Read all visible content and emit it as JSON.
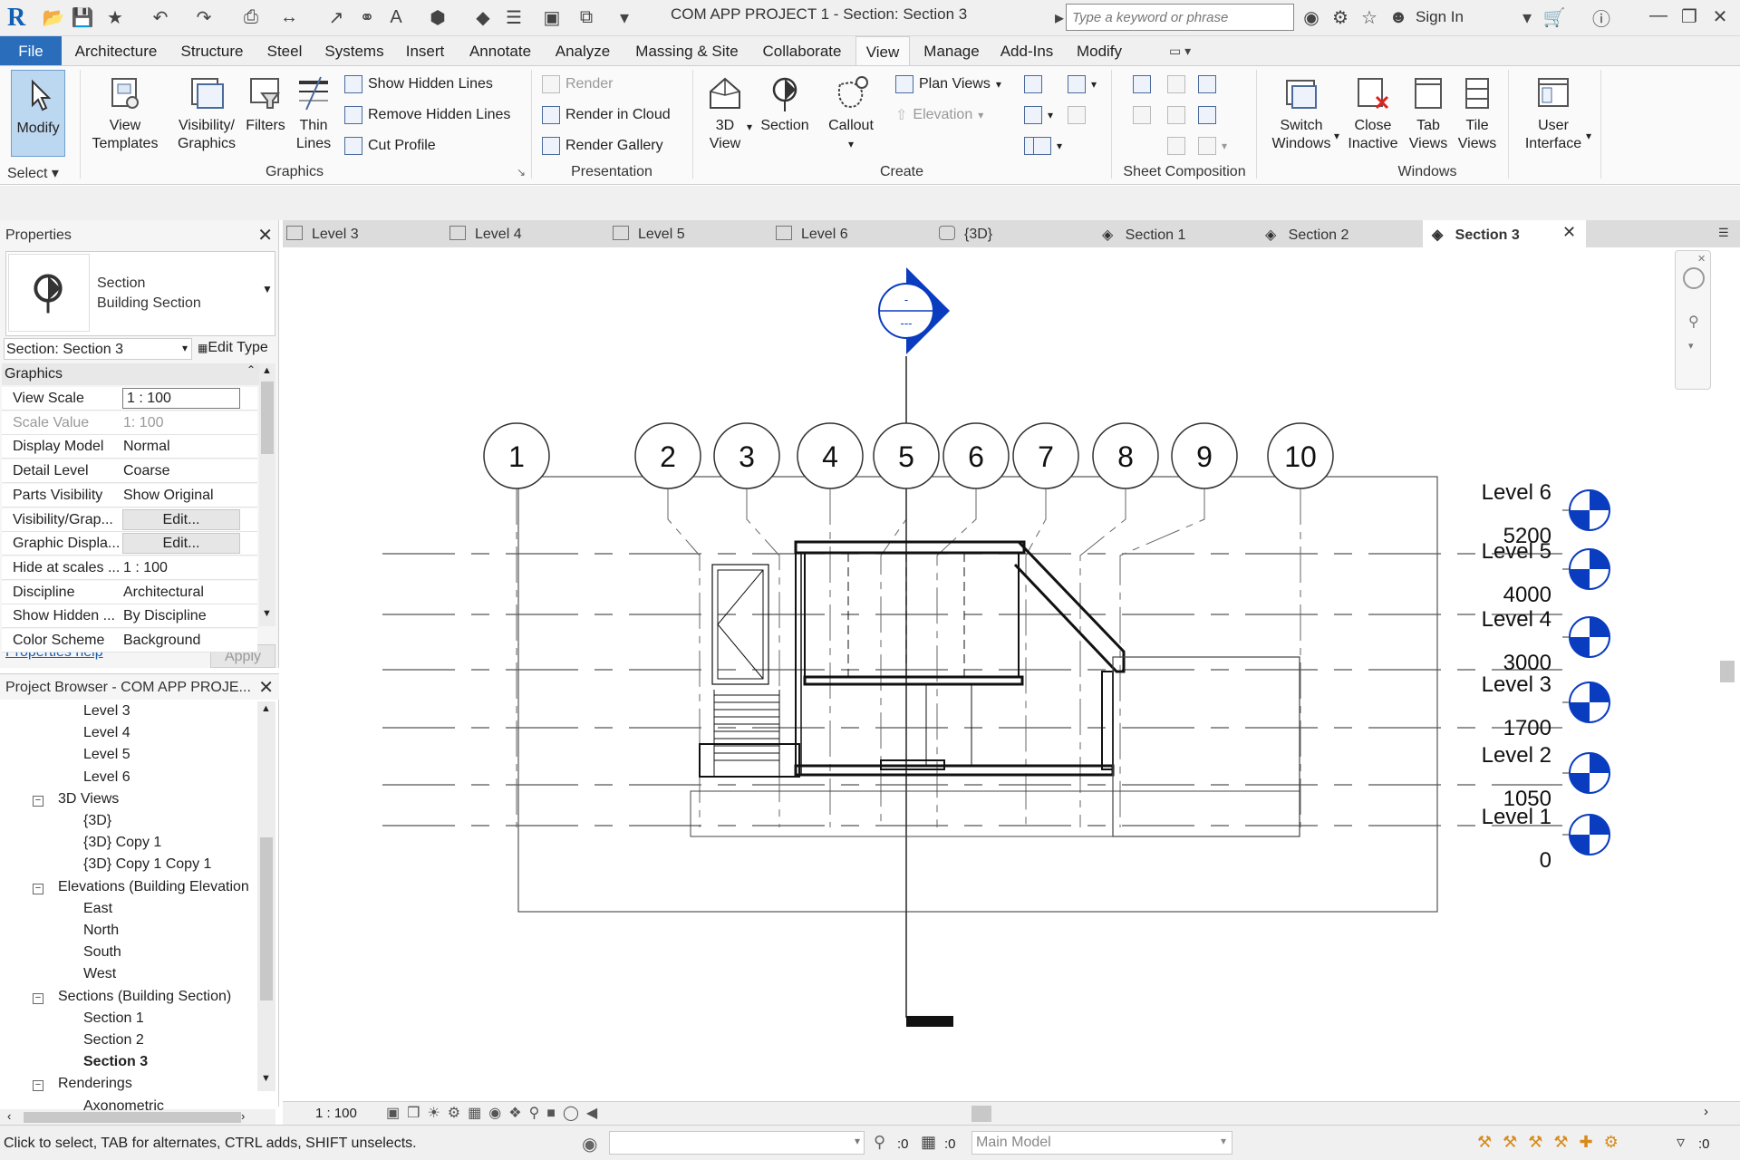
{
  "window": {
    "title": "COM APP PROJECT 1 - Section: Section 3",
    "search_placeholder": "Type a keyword or phrase",
    "signin": "Sign In"
  },
  "menu": {
    "tabs": [
      "File",
      "Architecture",
      "Structure",
      "Steel",
      "Systems",
      "Insert",
      "Annotate",
      "Analyze",
      "Massing & Site",
      "Collaborate",
      "View",
      "Manage",
      "Add-Ins",
      "Modify"
    ],
    "active": "View"
  },
  "ribbon": {
    "select": {
      "modify": "Modify",
      "title": "Select"
    },
    "graphics": {
      "view_templates": [
        "View",
        "Templates"
      ],
      "visibility": [
        "Visibility/",
        "Graphics"
      ],
      "filters": "Filters",
      "thin_lines": [
        "Thin",
        "Lines"
      ],
      "show_hidden": "Show  Hidden Lines",
      "remove_hidden": "Remove  Hidden Lines",
      "cut_profile": "Cut  Profile",
      "title": "Graphics"
    },
    "presentation": {
      "render": "Render",
      "render_cloud": "Render  in Cloud",
      "render_gallery": "Render  Gallery",
      "title": "Presentation"
    },
    "create": {
      "view3d": [
        "3D",
        "View"
      ],
      "section": "Section",
      "callout": "Callout",
      "plan_views": "Plan  Views",
      "elevation": "Elevation",
      "title": "Create"
    },
    "sheet": {
      "title": "Sheet Composition"
    },
    "windows": {
      "switch": [
        "Switch",
        "Windows"
      ],
      "close_inactive": [
        "Close",
        "Inactive"
      ],
      "tab_views": [
        "Tab",
        "Views"
      ],
      "tile_views": [
        "Tile",
        "Views"
      ],
      "user_interface": [
        "User",
        "Interface"
      ],
      "title": "Windows"
    }
  },
  "properties": {
    "title": "Properties",
    "type_line1": "Section",
    "type_line2": "Building Section",
    "instance": "Section: Section 3",
    "edit_type": "Edit Type",
    "group": "Graphics",
    "rows": [
      {
        "k": "View Scale",
        "v": "1 : 100"
      },
      {
        "k": "Scale Value",
        "v": "1:  100"
      },
      {
        "k": "Display Model",
        "v": "Normal"
      },
      {
        "k": "Detail Level",
        "v": "Coarse"
      },
      {
        "k": "Parts Visibility",
        "v": "Show Original"
      },
      {
        "k": "Visibility/Grap...",
        "v": "Edit..."
      },
      {
        "k": "Graphic Displa...",
        "v": "Edit..."
      },
      {
        "k": "Hide at scales ...",
        "v": "1 : 100"
      },
      {
        "k": "Discipline",
        "v": "Architectural"
      },
      {
        "k": "Show Hidden ...",
        "v": "By Discipline"
      },
      {
        "k": "Color Scheme",
        "v": "Background"
      }
    ],
    "help": "Properties help",
    "apply": "Apply"
  },
  "browser": {
    "title": "Project Browser - COM APP PROJE...",
    "items": [
      {
        "label": "Level 3",
        "indent": 2
      },
      {
        "label": "Level 4",
        "indent": 2
      },
      {
        "label": "Level 5",
        "indent": 2
      },
      {
        "label": "Level 6",
        "indent": 2
      },
      {
        "label": "3D Views",
        "indent": 1,
        "toggle": "−"
      },
      {
        "label": "{3D}",
        "indent": 2
      },
      {
        "label": "{3D} Copy 1",
        "indent": 2
      },
      {
        "label": "{3D} Copy 1 Copy 1",
        "indent": 2
      },
      {
        "label": "Elevations (Building Elevation",
        "indent": 1,
        "toggle": "−"
      },
      {
        "label": "East",
        "indent": 2
      },
      {
        "label": "North",
        "indent": 2
      },
      {
        "label": "South",
        "indent": 2
      },
      {
        "label": "West",
        "indent": 2
      },
      {
        "label": "Sections (Building Section)",
        "indent": 1,
        "toggle": "−"
      },
      {
        "label": "Section 1",
        "indent": 2
      },
      {
        "label": "Section 2",
        "indent": 2
      },
      {
        "label": "Section 3",
        "indent": 2,
        "bold": true
      },
      {
        "label": "Renderings",
        "indent": 1,
        "toggle": "−"
      },
      {
        "label": "Axonometric",
        "indent": 2
      }
    ]
  },
  "view_tabs": [
    "Level 3",
    "Level 4",
    "Level 5",
    "Level 6",
    "{3D}",
    "Section 1",
    "Section 2",
    "Section 3"
  ],
  "active_view_tab": "Section 3",
  "drawing": {
    "section_head_top": "-",
    "section_head_bottom": "---",
    "grids": [
      "1",
      "2",
      "3",
      "4",
      "5",
      "6",
      "7",
      "8",
      "9",
      "10"
    ],
    "levels": [
      {
        "name": "Level 6",
        "elev": "5200"
      },
      {
        "name": "Level 5",
        "elev": "4000"
      },
      {
        "name": "Level 4",
        "elev": "3000"
      },
      {
        "name": "Level 3",
        "elev": "1700"
      },
      {
        "name": "Level 2",
        "elev": "1050"
      },
      {
        "name": "Level 1",
        "elev": "0"
      }
    ],
    "accent": "#0a3cc0"
  },
  "view_control": {
    "scale": "1 : 100"
  },
  "status": {
    "text": "Click to select, TAB for alternates, CTRL adds, SHIFT unselects.",
    "filter_count": ":0",
    "model": "Main Model",
    "sel_count": ":0"
  }
}
